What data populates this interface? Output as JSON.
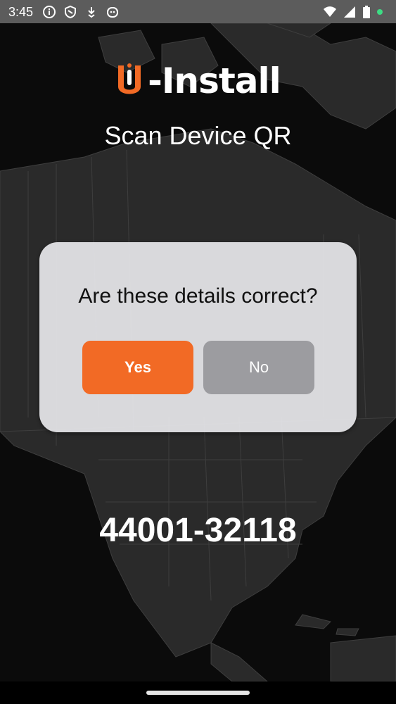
{
  "status_bar": {
    "time": "3:45",
    "left_icons": [
      "info-icon",
      "shield-icon",
      "download-icon",
      "face-icon"
    ],
    "right_icons": [
      "wifi-icon",
      "signal-icon",
      "battery-icon",
      "dot-icon"
    ]
  },
  "header": {
    "logo_text": "-Install",
    "title": "Scan Device QR"
  },
  "dialog": {
    "question": "Are these details correct?",
    "yes_label": "Yes",
    "no_label": "No"
  },
  "device": {
    "id": "44001-32118"
  },
  "colors": {
    "accent": "#f26a25",
    "secondary_button": "#9c9ca0",
    "dialog_bg": "#e8e8ec",
    "status_bar": "#5c5c5c"
  }
}
